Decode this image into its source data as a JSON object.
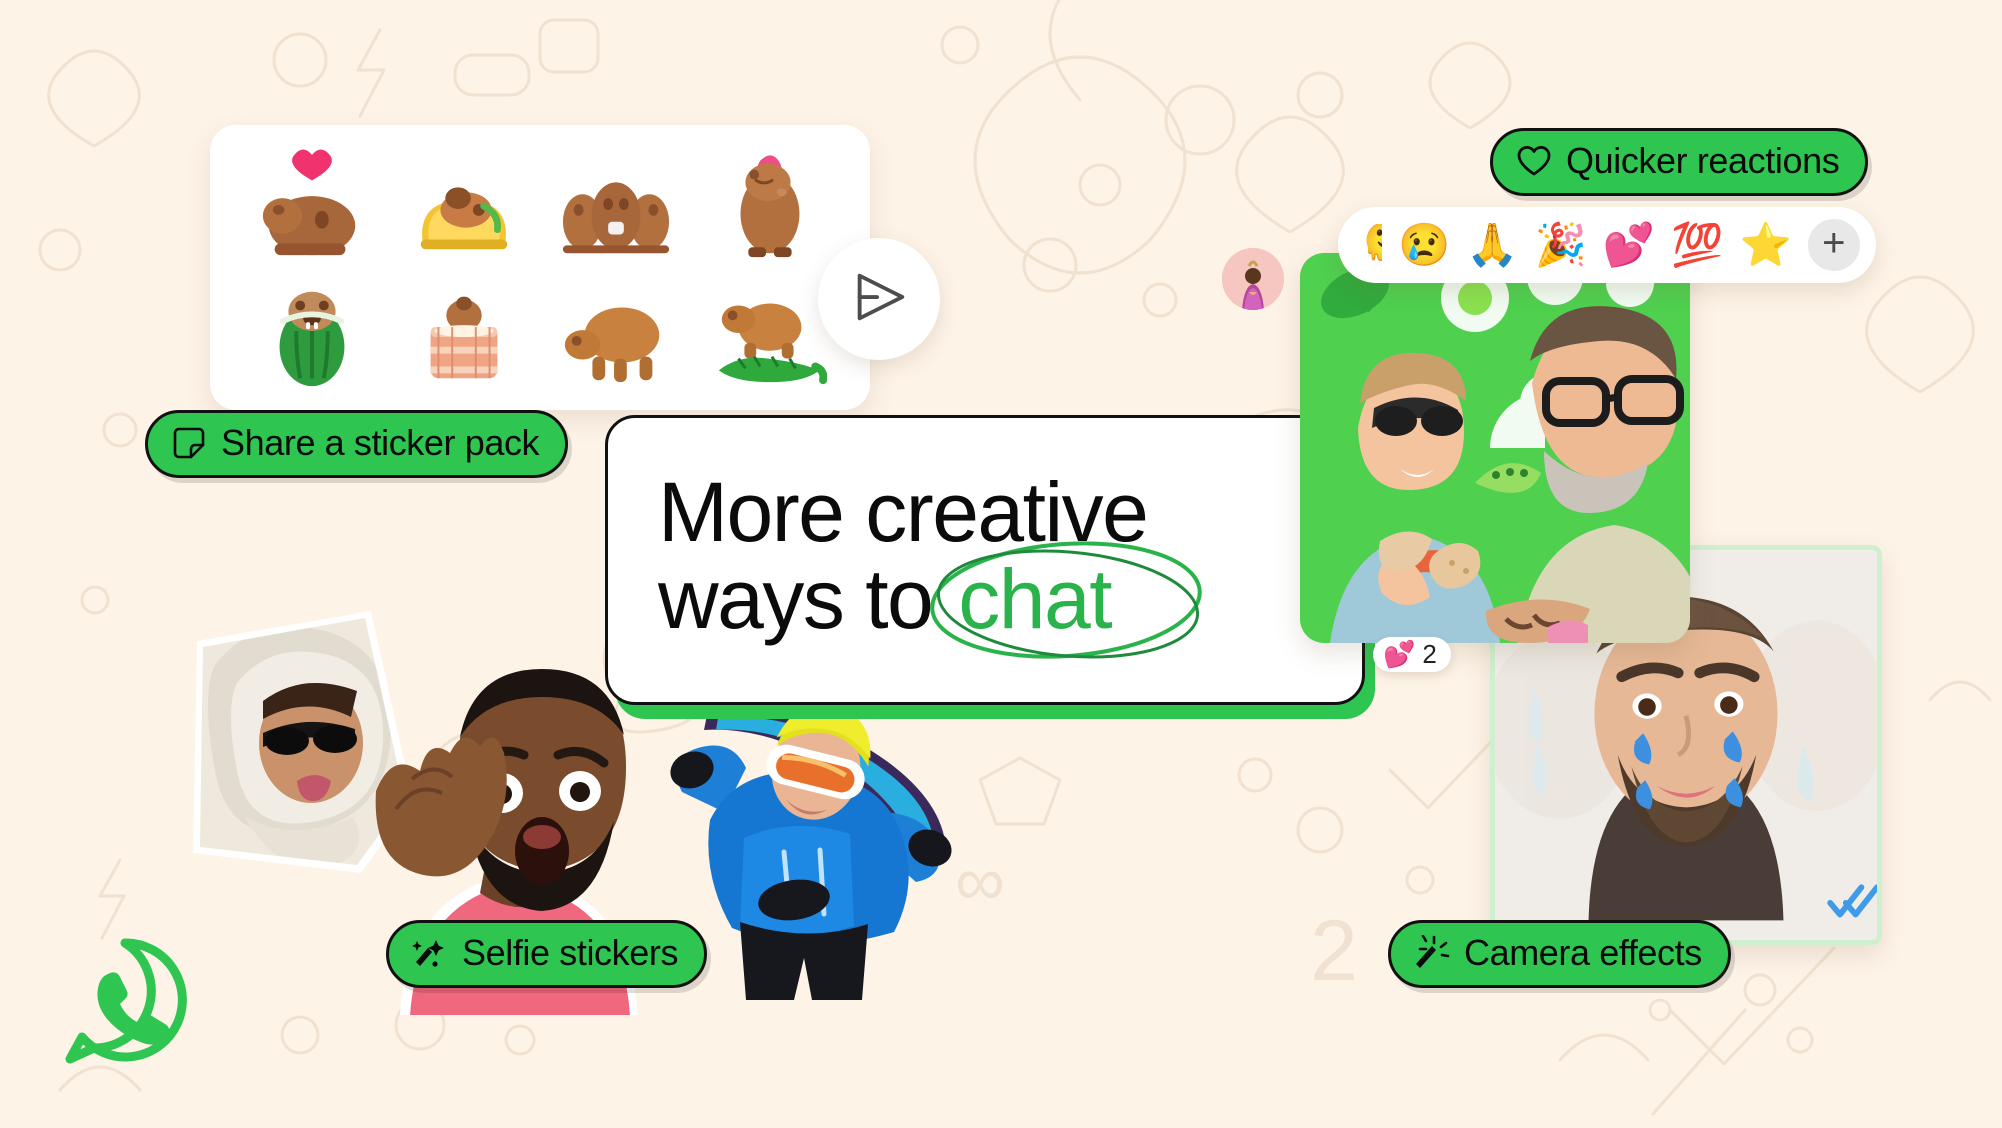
{
  "brand": {
    "name": "WhatsApp",
    "logo_icon": "whatsapp-logo-icon",
    "accent_green": "#2FC551",
    "chat_green": "#2BB34B",
    "background_cream": "#FDF3E7",
    "outline_black": "#111111"
  },
  "headline": {
    "line1": "More creative",
    "line2_prefix": "ways to",
    "line2_highlight": "chat"
  },
  "pills": [
    {
      "id": "share-a-sticker-pack",
      "label": "Share a sticker pack",
      "icon": "sticker-icon"
    },
    {
      "id": "quicker-reactions",
      "label": "Quicker reactions",
      "icon": "heart-outline-icon"
    },
    {
      "id": "selfie-stickers",
      "label": "Selfie stickers",
      "icon": "magic-wand-icon"
    },
    {
      "id": "camera-effects",
      "label": "Camera effects",
      "icon": "magic-wand-sparkle-icon"
    }
  ],
  "sticker_panel": {
    "send_icon": "send-icon",
    "stickers": [
      {
        "name": "capybara-with-heart",
        "emoji_hint": "capybara"
      },
      {
        "name": "capybara-in-taco",
        "emoji_hint": "capybara"
      },
      {
        "name": "three-capybaras-with-cup",
        "emoji_hint": "capybara"
      },
      {
        "name": "capybara-with-flower",
        "emoji_hint": "capybara"
      },
      {
        "name": "capybara-in-watermelon",
        "emoji_hint": "capybara"
      },
      {
        "name": "capybara-in-hot-tub",
        "emoji_hint": "capybara"
      },
      {
        "name": "capybara-walking",
        "emoji_hint": "capybara"
      },
      {
        "name": "capybara-on-crocodile",
        "emoji_hint": "capybara"
      }
    ]
  },
  "reaction_bar": {
    "emojis": [
      "🫠",
      "😢",
      "🙏",
      "🎉",
      "💕",
      "💯",
      "⭐"
    ],
    "add_label": "+",
    "add_icon": "plus-icon"
  },
  "reaction_badge": {
    "emoji": "💕",
    "count": "2"
  },
  "media": {
    "couple_photo": {
      "name": "couple-selfie-photo",
      "alt": "Two people smiling in a selfie on a green sticker background"
    },
    "camera_photo": {
      "name": "camera-effects-photo",
      "alt": "Man with blue teardrop camera effect stickers on his face"
    },
    "cutouts": [
      {
        "name": "hoodie-selfie-cutout",
        "alt": "Person in fluffy hood with sunglasses"
      },
      {
        "name": "shocked-selfie-cutout",
        "alt": "Person in pink shirt with shocked expression"
      },
      {
        "name": "snowboarder-cutout",
        "alt": "Snowboarder in blue jacket with yellow beanie"
      }
    ],
    "avatar": {
      "name": "contact-avatar",
      "alt": "Small round contact avatar"
    }
  },
  "status": {
    "read_receipt_icon": "double-check-icon"
  }
}
